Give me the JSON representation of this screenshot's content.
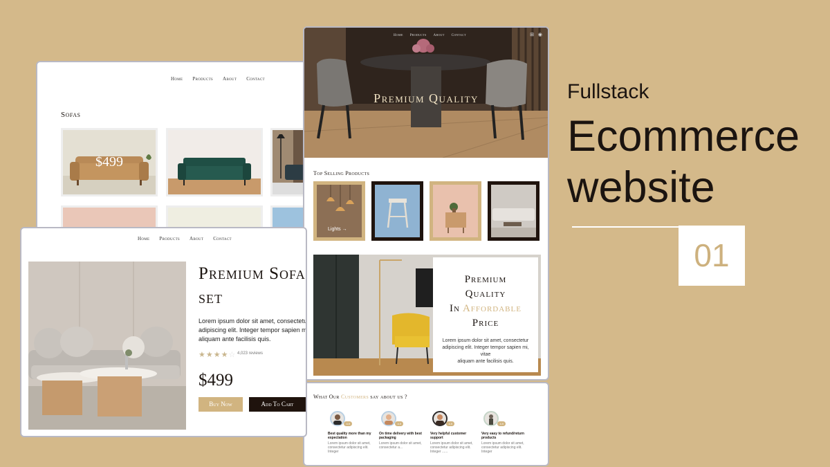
{
  "nav": {
    "home": "Home",
    "products": "Products",
    "about": "About",
    "contact": "Contact"
  },
  "sofas_page": {
    "title": "Sofas",
    "featured_price": "$499"
  },
  "product_page": {
    "title_line1": "Premium Sofa",
    "title_line2": "set",
    "desc_line1": "Lorem ipsum dolor sit amet, consectetur",
    "desc_line2": "adipiscing elit. Integer tempor sapien mi, v",
    "desc_line3": "aliquam ante facilisis quis.",
    "rating": 4,
    "stars_on": "★★★★",
    "stars_off": "☆",
    "reviews": "4,023 reviews",
    "price": "$499",
    "buy_now": "Buy Now",
    "add_to_cart": "Add To Cart"
  },
  "home_page": {
    "hero_title": "Premium Quality",
    "top_selling": "Top Selling Products",
    "tile_label": "Lights",
    "promo": {
      "line1": "Premium",
      "line2": "Quality",
      "line3_prefix": "In",
      "line3_accent": "Affordable",
      "line4": "Price",
      "desc_line1": "Lorem ipsum dolor sit amet, consectetur",
      "desc_line2": "adipiscing elit. Integer tempor sapien mi, vitae",
      "desc_line3": "aliquam ante facilisis quis."
    }
  },
  "testimonials": {
    "title_prefix": "What Our",
    "title_accent": "Customers",
    "title_suffix": "say about us ?",
    "cards": [
      {
        "rating": "4.9",
        "heading_line1": "Best quality more than my",
        "heading_line2": "expectation",
        "body_line1": "Lorem ipsum dolor sit amet,",
        "body_line2": "consectetur adipiscing elit.",
        "body_line3": "Integer"
      },
      {
        "rating": "4.9",
        "heading_line1": "On time delivery with best",
        "heading_line2": "packaging",
        "body_line1": "Lorem ipsum dolor sit amet,",
        "body_line2": "consectetur a...",
        "body_line3": ""
      },
      {
        "rating": "4.9",
        "heading_line1": "Very helpful customer",
        "heading_line2": "support",
        "body_line1": "Lorem ipsum dolor sit amet,",
        "body_line2": "consectetur adipiscing elit.",
        "body_line3": "Integer ......"
      },
      {
        "rating": "4.9",
        "heading_line1": "Very easy to refund/return",
        "heading_line2": "products",
        "body_line1": "Lorem ipsum dolor sit amet,",
        "body_line2": "consectetur adipiscing elit.",
        "body_line3": "Integer"
      }
    ]
  },
  "headline": {
    "subtitle": "Fullstack",
    "line1": "Ecommerce",
    "line2": "website",
    "number": "01"
  },
  "colors": {
    "background": "#d4b98a",
    "accent": "#d1b480",
    "dark": "#1f130d"
  }
}
